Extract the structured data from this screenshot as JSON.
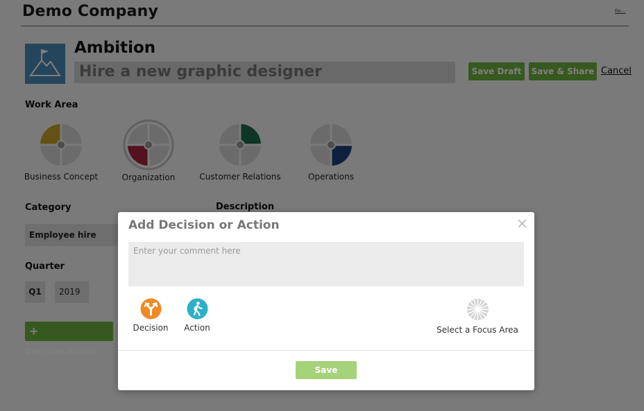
{
  "header": {
    "company": "Demo Company",
    "corner_link": "fin..."
  },
  "ambition": {
    "label": "Ambition",
    "title": "Hire a new graphic designer"
  },
  "actions": {
    "save_draft": "Save Draft",
    "save_share": "Save & Share",
    "cancel": "Cancel"
  },
  "work_area": {
    "label": "Work Area",
    "items": [
      {
        "label": "Business Concept",
        "color": "#c9a227"
      },
      {
        "label": "Organization",
        "color": "#a8233f"
      },
      {
        "label": "Customer Relations",
        "color": "#1f6b4a"
      },
      {
        "label": "Operations",
        "color": "#1e3f7a"
      }
    ]
  },
  "category": {
    "label": "Category",
    "value": "Employee hire"
  },
  "description": {
    "label": "Description"
  },
  "quarter": {
    "label": "Quarter",
    "q": "Q1",
    "year": "2019"
  },
  "add_button": {
    "label": "Decision/Action",
    "icon": "plus-icon"
  },
  "modal": {
    "title": "Add Decision or Action",
    "close_icon": "close-icon",
    "placeholder": "Enter your comment here",
    "decision": {
      "label": "Decision",
      "icon": "split-arrow-icon",
      "color": "#f08a24"
    },
    "action": {
      "label": "Action",
      "icon": "walking-person-icon",
      "color": "#2bb0c8"
    },
    "focus": {
      "label": "Select a Focus Area",
      "icon": "focus-wheel-icon"
    },
    "save": "Save"
  }
}
